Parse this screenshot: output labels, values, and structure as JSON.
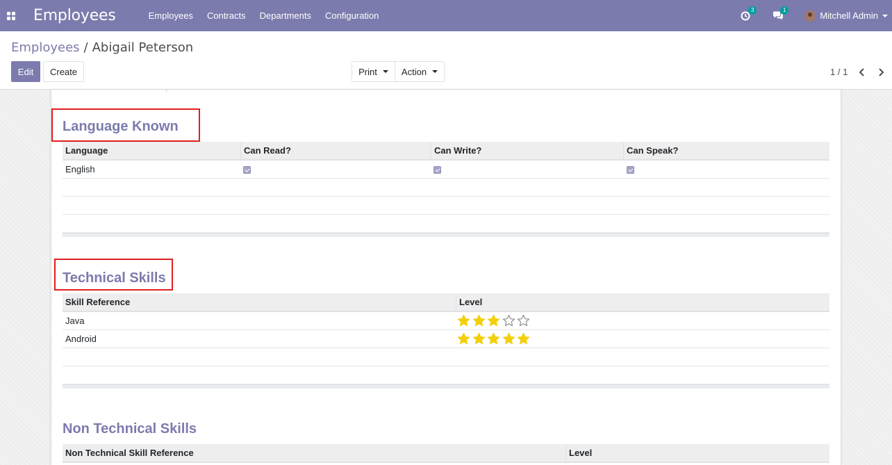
{
  "navbar": {
    "app_title": "Employees",
    "menu": [
      "Employees",
      "Contracts",
      "Departments",
      "Configuration"
    ],
    "activity_count": "3",
    "message_count": "1",
    "user_name": "Mitchell Admin"
  },
  "breadcrumb": {
    "parent": "Employees",
    "separator": "/",
    "current": "Abigail Peterson"
  },
  "control": {
    "edit_label": "Edit",
    "create_label": "Create",
    "print_label": "Print",
    "action_label": "Action",
    "pager": "1 / 1"
  },
  "languages": {
    "title": "Language Known",
    "headers": [
      "Language",
      "Can Read?",
      "Can Write?",
      "Can Speak?"
    ],
    "rows": [
      {
        "language": "English",
        "can_read": true,
        "can_write": true,
        "can_speak": true
      }
    ]
  },
  "technical_skills": {
    "title": "Technical Skills",
    "headers": [
      "Skill Reference",
      "Level"
    ],
    "rows": [
      {
        "skill": "Java",
        "level": 3,
        "max": 5
      },
      {
        "skill": "Android",
        "level": 5,
        "max": 5
      }
    ]
  },
  "non_technical_skills": {
    "title": "Non Technical Skills",
    "headers": [
      "Non Technical Skill Reference",
      "Level"
    ]
  },
  "colors": {
    "brand": "#7c7bad",
    "star": "#f2cf0a",
    "highlight": "#e01e1e",
    "badge": "#00a09d"
  }
}
